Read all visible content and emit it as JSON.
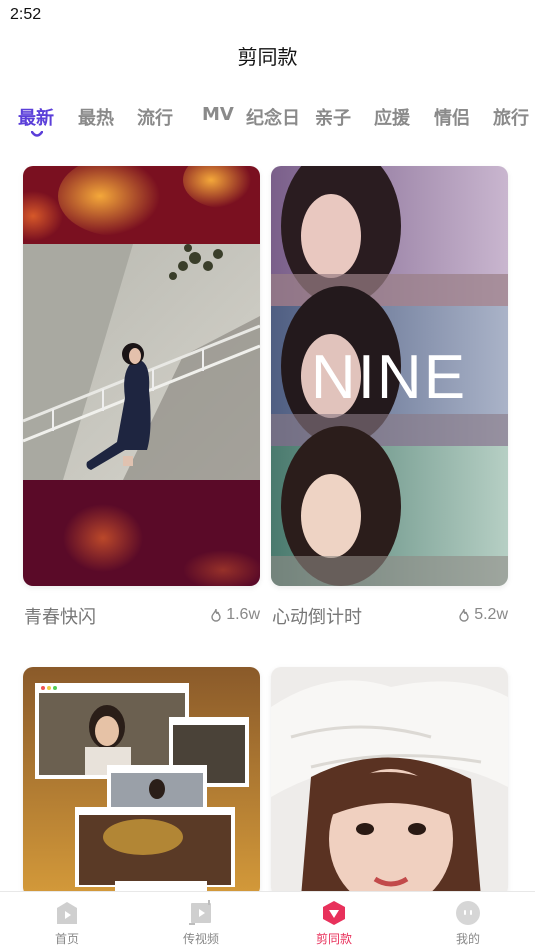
{
  "status": {
    "time": "2:52"
  },
  "header": {
    "title": "剪同款"
  },
  "tabs": [
    {
      "label": "最新",
      "active": true
    },
    {
      "label": "最热",
      "active": false
    },
    {
      "label": "流行",
      "active": false
    },
    {
      "label": "MV",
      "active": false
    },
    {
      "label": "纪念日",
      "active": false
    },
    {
      "label": "亲子",
      "active": false
    },
    {
      "label": "应援",
      "active": false
    },
    {
      "label": "情侣",
      "active": false
    },
    {
      "label": "旅行",
      "active": false
    }
  ],
  "cards": [
    {
      "title": "青春快闪",
      "count": "1.6w",
      "overlay_text": ""
    },
    {
      "title": "心动倒计时",
      "count": "5.2w",
      "overlay_text": "NINE"
    },
    {
      "title": "",
      "count": "",
      "overlay_text": ""
    },
    {
      "title": "",
      "count": "",
      "overlay_text": ""
    }
  ],
  "bottom_nav": [
    {
      "label": "首页",
      "icon": "home-icon",
      "active": false
    },
    {
      "label": "传视频",
      "icon": "upload-video-icon",
      "active": false
    },
    {
      "label": "剪同款",
      "icon": "template-play-icon",
      "active": true
    },
    {
      "label": "我的",
      "icon": "profile-face-icon",
      "active": false
    }
  ],
  "colors": {
    "accent_tab": "#5b3fd9",
    "accent_nav": "#e8315b"
  }
}
